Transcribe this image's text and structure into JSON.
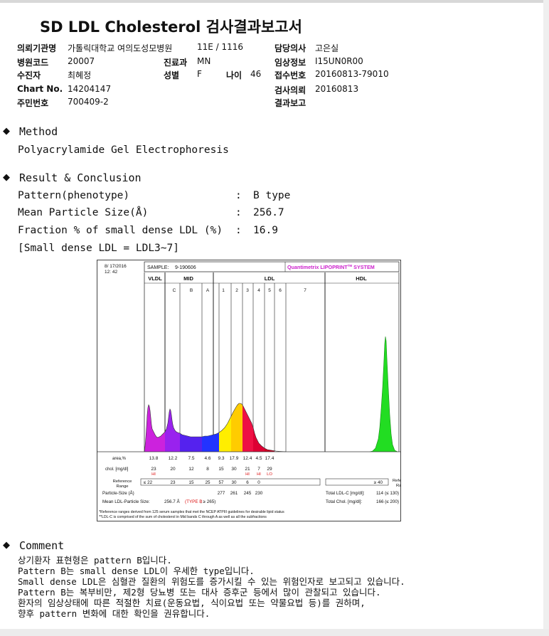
{
  "title": "SD LDL Cholesterol 검사결과보고서",
  "header": {
    "institution_label": "의뢰기관명",
    "institution_value": "가톨릭대학교 여의도성모병원",
    "ward_value": "11E / 1116",
    "physician_label": "담당의사",
    "physician_value": "고은실",
    "hospital_code_label": "병원코드",
    "hospital_code_value": "20007",
    "dept_label": "진료과",
    "dept_value": "MN",
    "clinical_label": "임상정보",
    "clinical_value": "I15UN0R00",
    "subject_label": "수진자",
    "subject_value": "최혜정",
    "sex_label": "성별",
    "sex_value": "F",
    "age_label": "나이",
    "age_value": "46",
    "receipt_label": "접수번호",
    "receipt_value": "20160813-79010",
    "chart_label": "Chart No.",
    "chart_value": "14204147",
    "request_label": "검사의뢰",
    "request_value": "20160813",
    "id_label": "주민번호",
    "id_value": "700409-2",
    "report_label": "결과보고",
    "report_value": ""
  },
  "method": {
    "heading": "Method",
    "text": "Polyacrylamide Gel Electrophoresis"
  },
  "result": {
    "heading": "Result & Conclusion",
    "rows": [
      {
        "label": "Pattern(phenotype)",
        "sep": ":",
        "value": "B type"
      },
      {
        "label": "Mean Particle Size(Å)",
        "sep": ":",
        "value": "256.7"
      },
      {
        "label": "Fraction % of small dense LDL (%)",
        "sep": ":",
        "value": "16.9"
      }
    ],
    "note": "[Small dense LDL = LDL3~7]"
  },
  "chart_data": {
    "type": "area",
    "date": "8/ 17/2016",
    "time": "12: 42",
    "sample_label": "SAMPLE:",
    "sample_value": "9-190606",
    "brand": "Quantimetrix LIPOPRINT",
    "brand_sup": "TM",
    "brand_tail": " SYSTEM",
    "groups": [
      "VLDL",
      "MID",
      "LDL",
      "HDL"
    ],
    "bands": [
      "C",
      "B",
      "A",
      "1",
      "2",
      "3",
      "4",
      "5",
      "6",
      "7"
    ],
    "band_colors": {
      "VLDL": "#cc22dd",
      "C": "#9922ee",
      "B": "#5522ee",
      "A": "#2233ff",
      "1": "#ffee00",
      "2": "#ffcc00",
      "3": "#ee1144",
      "4": "#dd0033",
      "5": "#cc0022",
      "HDL": "#22dd22"
    },
    "area_label": "area,%",
    "area_values": [
      "13.8",
      "12.2",
      "7.5",
      "4.6",
      "9.3",
      "17.9",
      "12.4",
      "4.5",
      "17.4"
    ],
    "chol_label": "chol. [mg/dl]",
    "chol_values": [
      "23",
      "20",
      "12",
      "8",
      "15",
      "30",
      "21",
      "7",
      "29"
    ],
    "flags": [
      "HI",
      "",
      "",
      "",
      "",
      "",
      "HI",
      "HI",
      "LO"
    ],
    "ref_label": "Reference Range",
    "ref_values": [
      "≤ 22",
      "23",
      "15",
      "25",
      "57",
      "30",
      "6",
      "0",
      "≥ 40"
    ],
    "ref_label_right": "Reference Range",
    "particle_label": "Particle-Size (Å)",
    "particle_values": [
      "277",
      "261",
      "245",
      "230"
    ],
    "mean_label": "Mean LDL-Particle Size:",
    "mean_value": "256.7 Å",
    "mean_type": "(TYPE B",
    "mean_tail": "; ≥ 265)",
    "total_ldl_label": "Total LDL-C [mg/dl]:",
    "total_ldl_value": "114",
    "total_ldl_ref": "(≤ 130)",
    "total_chol_label": "Total Chol. [mg/dl]:",
    "total_chol_value": "166",
    "total_chol_ref": "(≤ 200)",
    "footnote1": "*Reference ranges derived from 125 serum samples that met the NCEP ATPIII guidelines for desirable lipid status",
    "footnote2": "**LDL-C is comprised of the sum of cholesterol in Mid bands C through A as well as all the subfractions"
  },
  "comment": {
    "heading": "Comment",
    "lines": [
      "상기환자 표현형은 pattern B입니다.",
      "Pattern B는 small dense LDL이 우세한 type입니다.",
      "Small dense LDL은 심혈관 질환의 위험도를 증가시킬 수 있는 위험인자로 보고되고 있습니다.",
      "Pattern B는 복부비만, 제2형 당뇨병 또는 대사 증후군 등에서 많이 관찰되고 있습니다.",
      "환자의 임상상태에 따른 적절한 치료(운동요법, 식이요법 또는 약물요법 등)를 권하며,",
      "향후 pattern 변화에 대한 확인을 권유합니다."
    ]
  }
}
